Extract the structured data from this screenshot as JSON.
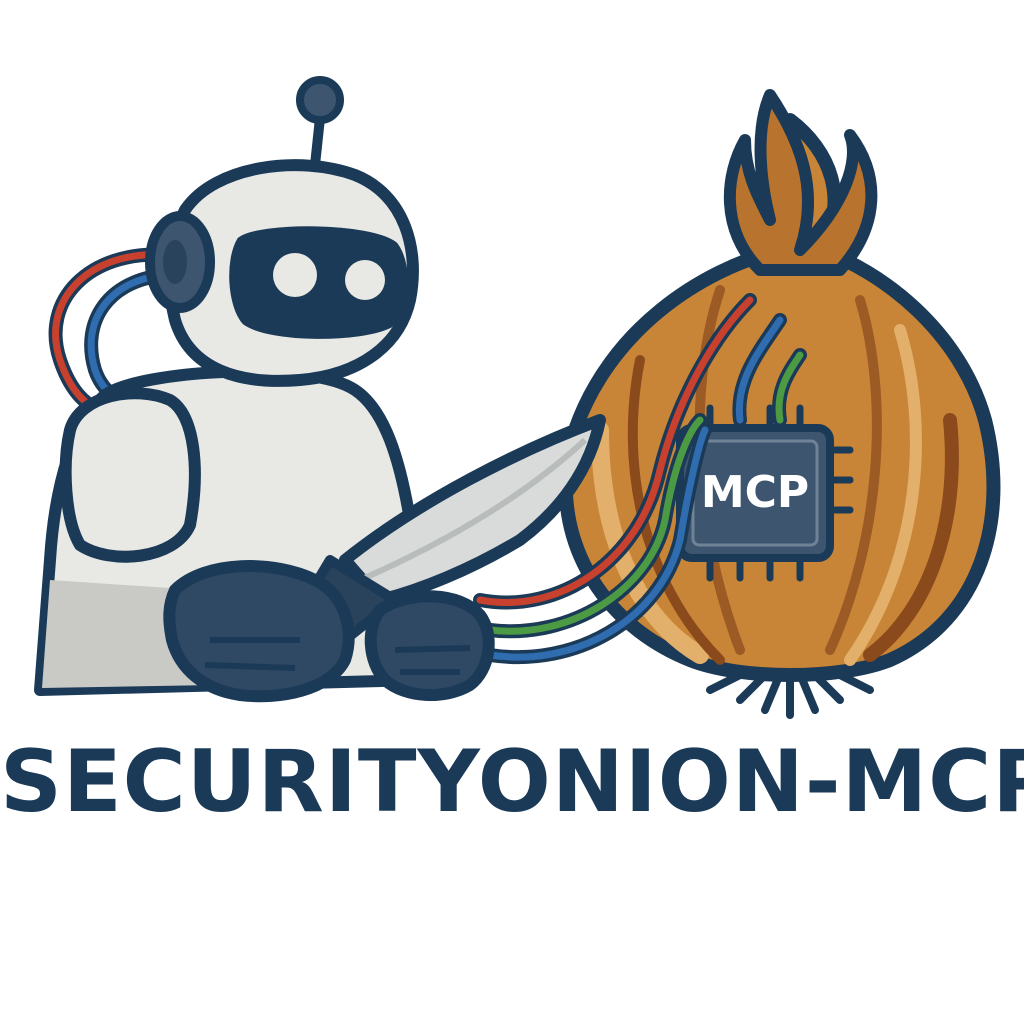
{
  "logo": {
    "chip_label": "MCP",
    "wordmark": "SECURITYONION-MCP"
  },
  "icons": {
    "robot": "robot-icon",
    "knife": "knife-icon",
    "onion": "onion-icon",
    "chip": "chip-icon",
    "cables": "cables-icon"
  },
  "colors": {
    "outline": "#1b3a57",
    "robot_body": "#e8e8e4",
    "robot_shadow": "#c9c9c5",
    "onion_light": "#d8a055",
    "onion_mid": "#b8742e",
    "onion_dark": "#8a4a1c",
    "cable_red": "#c8402e",
    "cable_green": "#4c9a44",
    "cable_blue": "#2f6db0",
    "chip_fill": "#3e5570"
  }
}
